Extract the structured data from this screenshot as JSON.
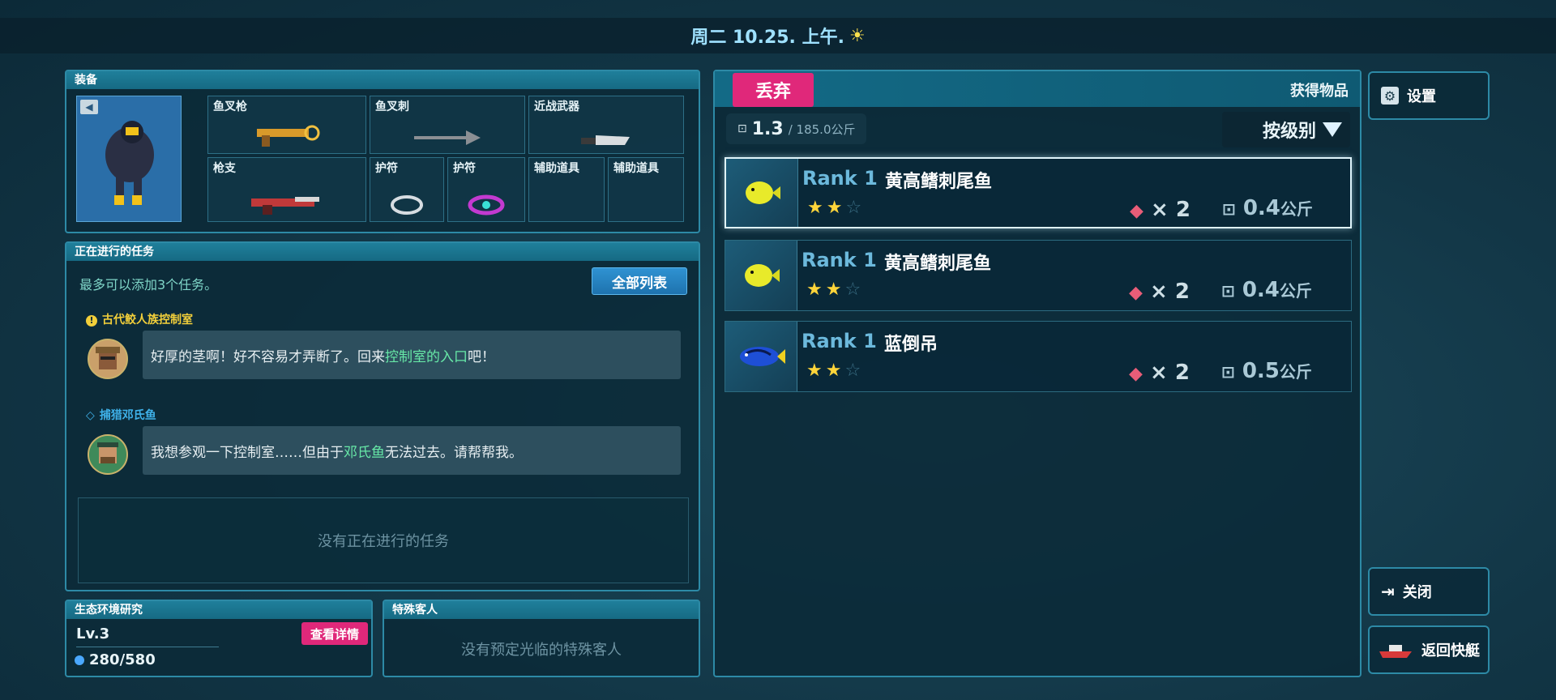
{
  "header": {
    "date_text": "周二 10.25. 上午.",
    "weather_icon": "sun-icon"
  },
  "equipment": {
    "title": "装备",
    "slots": {
      "harpoon_gun": "鱼叉枪",
      "harpoon": "鱼叉刺",
      "melee": "近战武器",
      "gun": "枪支",
      "charm1": "护符",
      "charm2": "护符",
      "aux1": "辅助道具",
      "aux2": "辅助道具"
    }
  },
  "missions": {
    "title": "正在进行的任务",
    "hint": "最多可以添加3个任务。",
    "list_button": "全部列表",
    "items": [
      {
        "title": "古代鲛人族控制室",
        "text_a": "好厚的茎啊！好不容易才弄断了。回来",
        "text_hl": "控制室的入口",
        "text_b": "吧！"
      },
      {
        "title": "捕猎邓氏鱼",
        "text_a": "我想参观一下控制室……但由于",
        "text_hl": "邓氏鱼",
        "text_b": "无法过去。请帮帮我。"
      }
    ],
    "empty": "没有正在进行的任务"
  },
  "eco": {
    "title": "生态环境研究",
    "level": "Lv.3",
    "details_button": "查看详情",
    "progress": "280/580",
    "progress_fraction": 0.483
  },
  "guest": {
    "title": "特殊客人",
    "empty": "没有预定光临的特殊客人"
  },
  "items_panel": {
    "discard_button": "丢弃",
    "title": "获得物品",
    "weight_current": "1.3",
    "weight_capacity": "/ 185.0公斤",
    "sort_button": "按级别",
    "items": [
      {
        "rank": "Rank 1",
        "name": "黄高鳍刺尾鱼",
        "stars": 2,
        "count": "× 2",
        "weight": "0.4",
        "unit": "公斤",
        "fish": "yellow-tang",
        "color": "#e8ea2a"
      },
      {
        "rank": "Rank 1",
        "name": "黄高鳍刺尾鱼",
        "stars": 2,
        "count": "× 2",
        "weight": "0.4",
        "unit": "公斤",
        "fish": "yellow-tang",
        "color": "#e8ea2a"
      },
      {
        "rank": "Rank 1",
        "name": "蓝倒吊",
        "stars": 2,
        "count": "× 2",
        "weight": "0.5",
        "unit": "公斤",
        "fish": "blue-tang",
        "color": "#1e4fd6"
      }
    ]
  },
  "side": {
    "settings": "设置",
    "close": "关闭",
    "return_boat": "返回快艇"
  }
}
